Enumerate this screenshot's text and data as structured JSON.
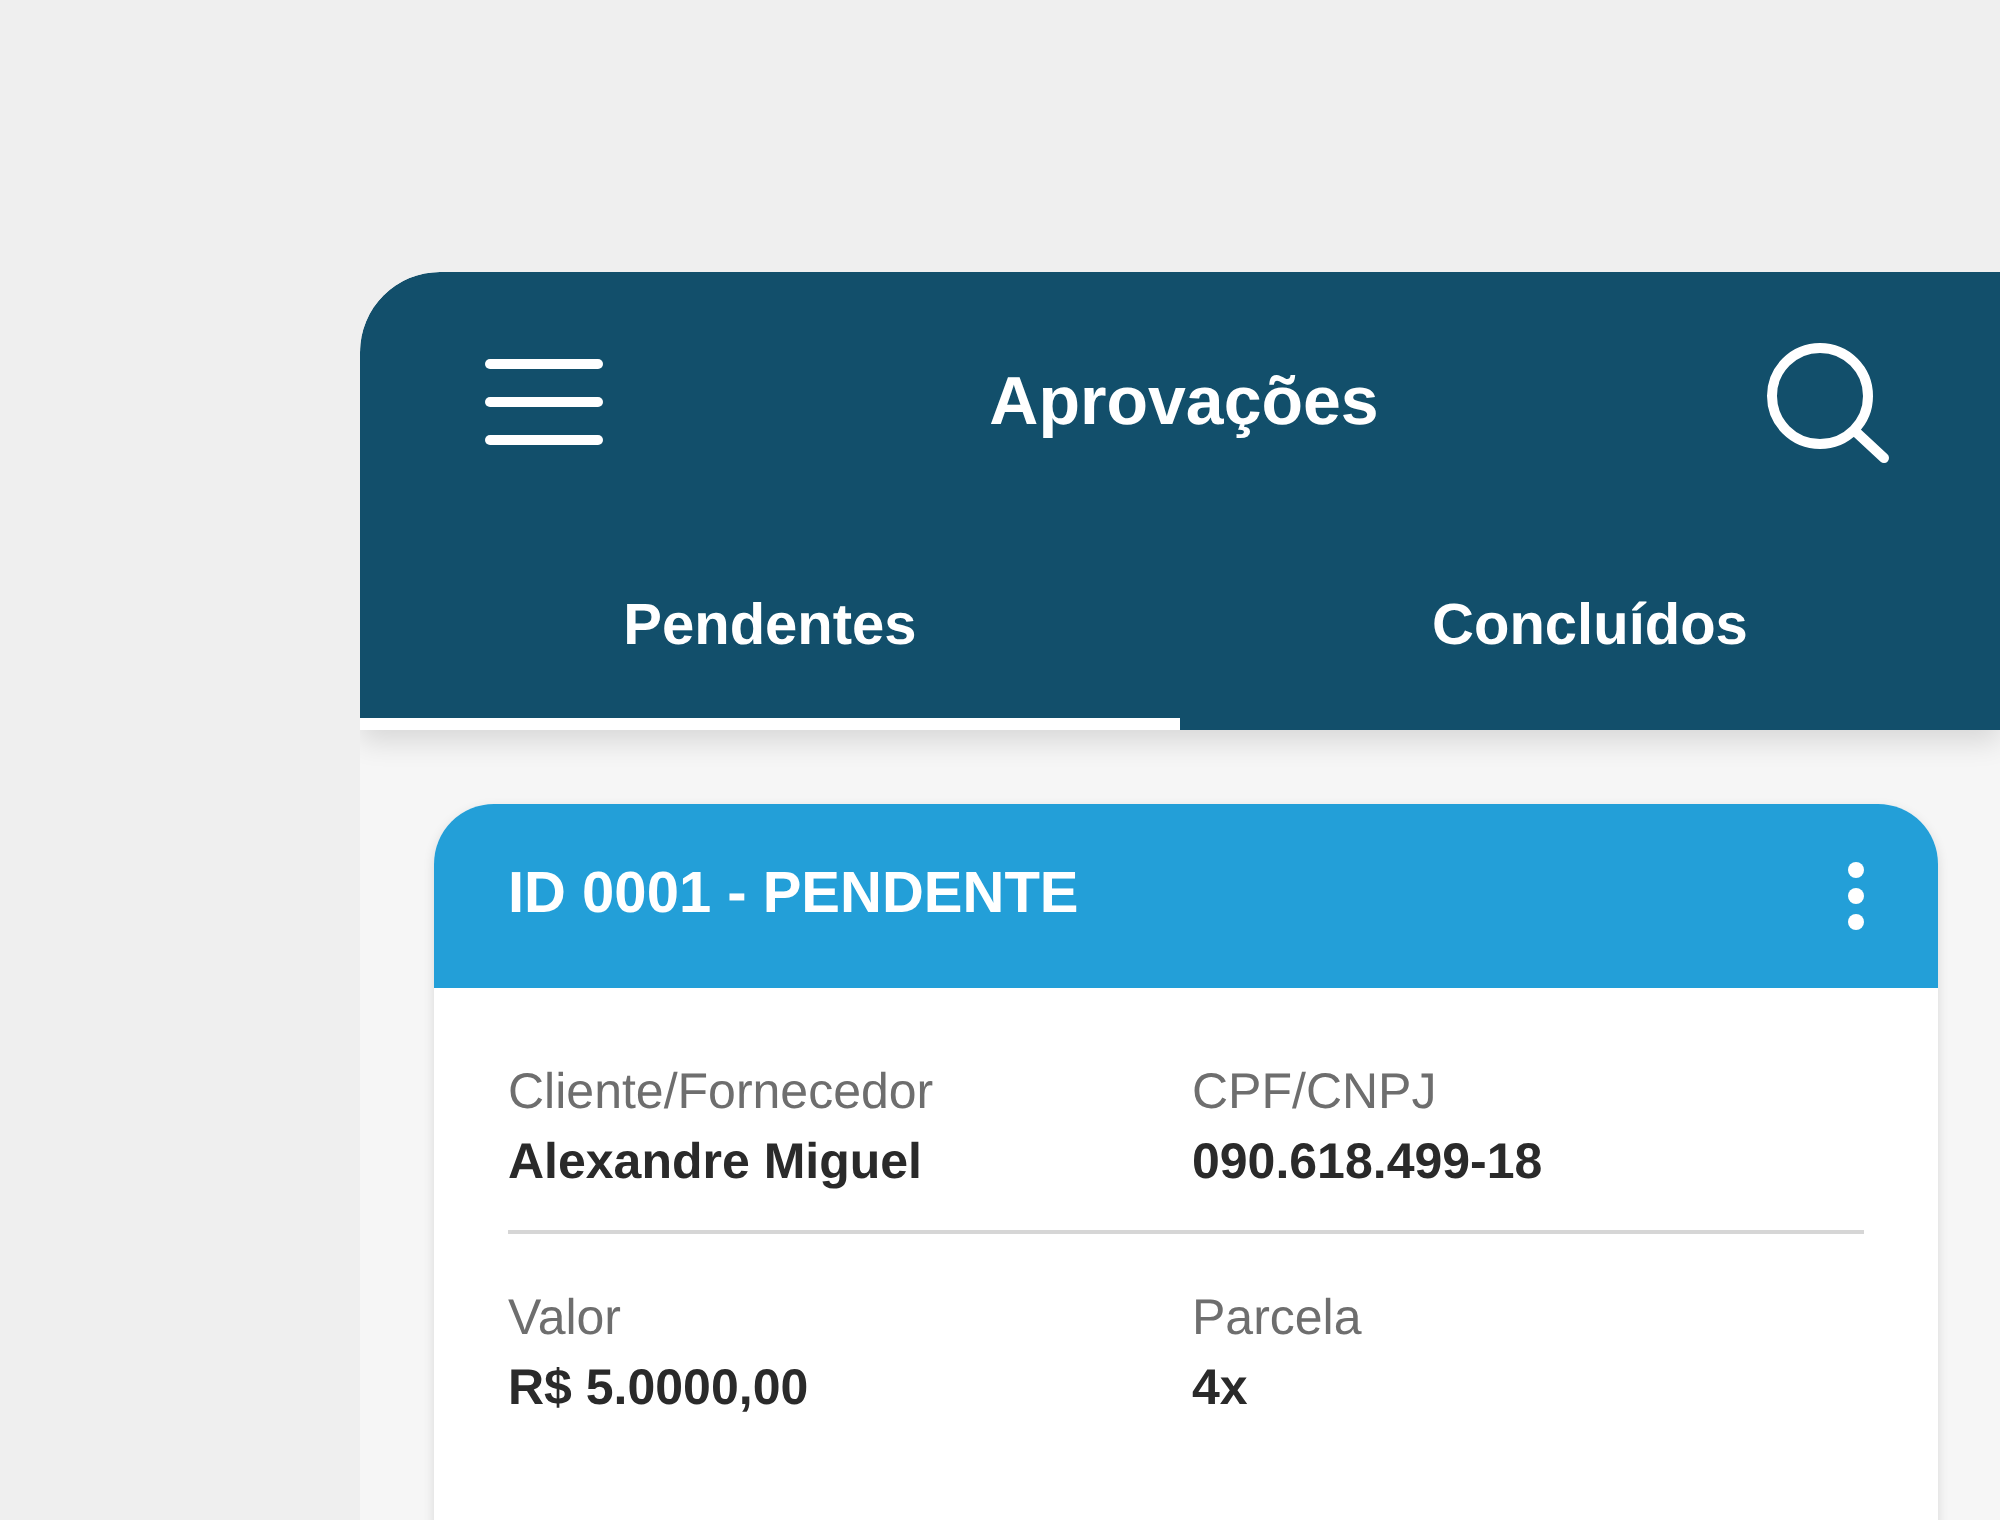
{
  "app_bar": {
    "title": "Aprovações"
  },
  "tabs": [
    {
      "label": "Pendentes",
      "selected": true
    },
    {
      "label": "Concluídos",
      "selected": false
    }
  ],
  "cards": [
    {
      "title": "ID 0001 - PENDENTE",
      "rows": [
        [
          {
            "label": "Cliente/Fornecedor",
            "value": "Alexandre Miguel"
          },
          {
            "label": "CPF/CNPJ",
            "value": "090.618.499-18"
          }
        ],
        [
          {
            "label": "Valor",
            "value": "R$ 5.0000,00"
          },
          {
            "label": "Parcela",
            "value": "4x"
          }
        ]
      ]
    }
  ]
}
